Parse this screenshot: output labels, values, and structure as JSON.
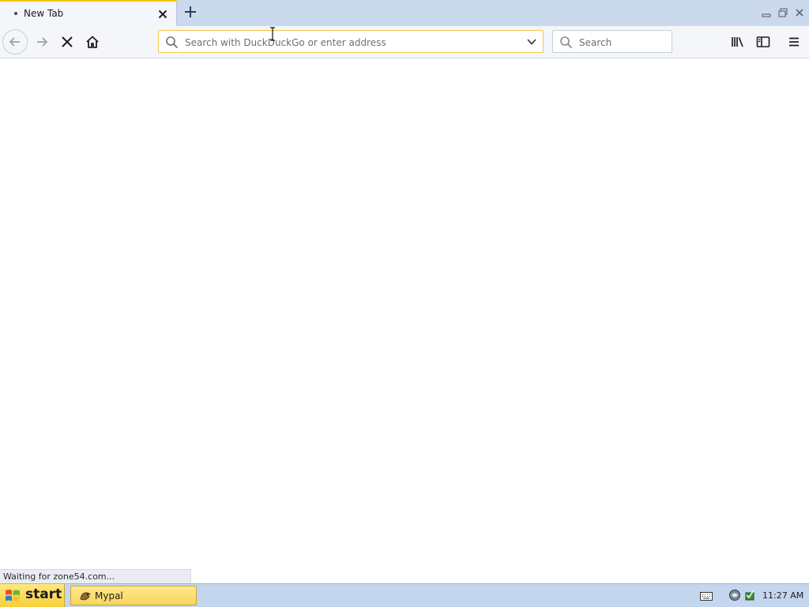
{
  "window": {
    "tab": {
      "title": "New Tab"
    },
    "controls": [
      "minimize-icon",
      "restore-icon",
      "close-icon"
    ]
  },
  "toolbar": {
    "url_placeholder": "Search with DuckDuckGo or enter address",
    "url_value": "",
    "search_placeholder": "Search",
    "icons": [
      "back-icon",
      "forward-icon",
      "stop-icon",
      "home-icon",
      "library-icon",
      "sidebar-icon",
      "menu-icon"
    ]
  },
  "status": {
    "text": "Waiting for zone54.com..."
  },
  "taskbar": {
    "start_label": "start",
    "task_label": "Mypal",
    "clock": "11:27 AM"
  },
  "colors": {
    "tab_accent": "#f5c400",
    "tabstrip_bg": "#cad9ec",
    "url_border": "#f2c94c",
    "taskbar_bg": "#c4d6ee",
    "start_bg": "#f7cf3c"
  }
}
